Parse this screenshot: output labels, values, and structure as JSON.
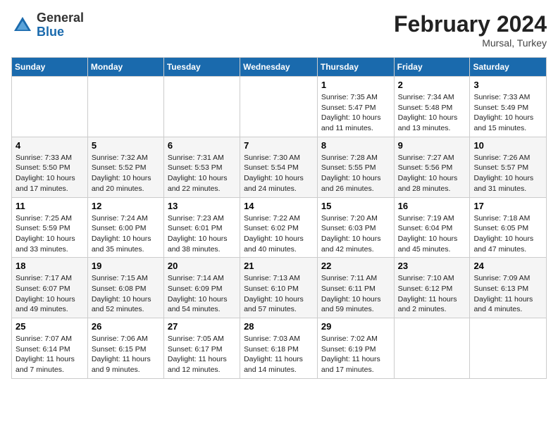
{
  "logo": {
    "general": "General",
    "blue": "Blue"
  },
  "header": {
    "month_year": "February 2024",
    "location": "Mursal, Turkey"
  },
  "columns": [
    "Sunday",
    "Monday",
    "Tuesday",
    "Wednesday",
    "Thursday",
    "Friday",
    "Saturday"
  ],
  "weeks": [
    [
      {
        "day": "",
        "info": ""
      },
      {
        "day": "",
        "info": ""
      },
      {
        "day": "",
        "info": ""
      },
      {
        "day": "",
        "info": ""
      },
      {
        "day": "1",
        "info": "Sunrise: 7:35 AM\nSunset: 5:47 PM\nDaylight: 10 hours and 11 minutes."
      },
      {
        "day": "2",
        "info": "Sunrise: 7:34 AM\nSunset: 5:48 PM\nDaylight: 10 hours and 13 minutes."
      },
      {
        "day": "3",
        "info": "Sunrise: 7:33 AM\nSunset: 5:49 PM\nDaylight: 10 hours and 15 minutes."
      }
    ],
    [
      {
        "day": "4",
        "info": "Sunrise: 7:33 AM\nSunset: 5:50 PM\nDaylight: 10 hours and 17 minutes."
      },
      {
        "day": "5",
        "info": "Sunrise: 7:32 AM\nSunset: 5:52 PM\nDaylight: 10 hours and 20 minutes."
      },
      {
        "day": "6",
        "info": "Sunrise: 7:31 AM\nSunset: 5:53 PM\nDaylight: 10 hours and 22 minutes."
      },
      {
        "day": "7",
        "info": "Sunrise: 7:30 AM\nSunset: 5:54 PM\nDaylight: 10 hours and 24 minutes."
      },
      {
        "day": "8",
        "info": "Sunrise: 7:28 AM\nSunset: 5:55 PM\nDaylight: 10 hours and 26 minutes."
      },
      {
        "day": "9",
        "info": "Sunrise: 7:27 AM\nSunset: 5:56 PM\nDaylight: 10 hours and 28 minutes."
      },
      {
        "day": "10",
        "info": "Sunrise: 7:26 AM\nSunset: 5:57 PM\nDaylight: 10 hours and 31 minutes."
      }
    ],
    [
      {
        "day": "11",
        "info": "Sunrise: 7:25 AM\nSunset: 5:59 PM\nDaylight: 10 hours and 33 minutes."
      },
      {
        "day": "12",
        "info": "Sunrise: 7:24 AM\nSunset: 6:00 PM\nDaylight: 10 hours and 35 minutes."
      },
      {
        "day": "13",
        "info": "Sunrise: 7:23 AM\nSunset: 6:01 PM\nDaylight: 10 hours and 38 minutes."
      },
      {
        "day": "14",
        "info": "Sunrise: 7:22 AM\nSunset: 6:02 PM\nDaylight: 10 hours and 40 minutes."
      },
      {
        "day": "15",
        "info": "Sunrise: 7:20 AM\nSunset: 6:03 PM\nDaylight: 10 hours and 42 minutes."
      },
      {
        "day": "16",
        "info": "Sunrise: 7:19 AM\nSunset: 6:04 PM\nDaylight: 10 hours and 45 minutes."
      },
      {
        "day": "17",
        "info": "Sunrise: 7:18 AM\nSunset: 6:05 PM\nDaylight: 10 hours and 47 minutes."
      }
    ],
    [
      {
        "day": "18",
        "info": "Sunrise: 7:17 AM\nSunset: 6:07 PM\nDaylight: 10 hours and 49 minutes."
      },
      {
        "day": "19",
        "info": "Sunrise: 7:15 AM\nSunset: 6:08 PM\nDaylight: 10 hours and 52 minutes."
      },
      {
        "day": "20",
        "info": "Sunrise: 7:14 AM\nSunset: 6:09 PM\nDaylight: 10 hours and 54 minutes."
      },
      {
        "day": "21",
        "info": "Sunrise: 7:13 AM\nSunset: 6:10 PM\nDaylight: 10 hours and 57 minutes."
      },
      {
        "day": "22",
        "info": "Sunrise: 7:11 AM\nSunset: 6:11 PM\nDaylight: 10 hours and 59 minutes."
      },
      {
        "day": "23",
        "info": "Sunrise: 7:10 AM\nSunset: 6:12 PM\nDaylight: 11 hours and 2 minutes."
      },
      {
        "day": "24",
        "info": "Sunrise: 7:09 AM\nSunset: 6:13 PM\nDaylight: 11 hours and 4 minutes."
      }
    ],
    [
      {
        "day": "25",
        "info": "Sunrise: 7:07 AM\nSunset: 6:14 PM\nDaylight: 11 hours and 7 minutes."
      },
      {
        "day": "26",
        "info": "Sunrise: 7:06 AM\nSunset: 6:15 PM\nDaylight: 11 hours and 9 minutes."
      },
      {
        "day": "27",
        "info": "Sunrise: 7:05 AM\nSunset: 6:17 PM\nDaylight: 11 hours and 12 minutes."
      },
      {
        "day": "28",
        "info": "Sunrise: 7:03 AM\nSunset: 6:18 PM\nDaylight: 11 hours and 14 minutes."
      },
      {
        "day": "29",
        "info": "Sunrise: 7:02 AM\nSunset: 6:19 PM\nDaylight: 11 hours and 17 minutes."
      },
      {
        "day": "",
        "info": ""
      },
      {
        "day": "",
        "info": ""
      }
    ]
  ]
}
